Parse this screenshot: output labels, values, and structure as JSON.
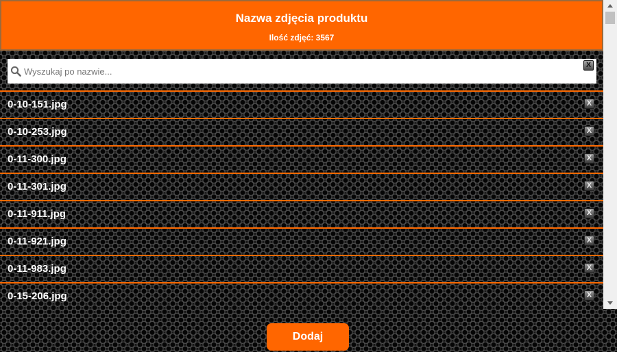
{
  "header": {
    "title": "Nazwa zdjęcia produktu",
    "count_label": "Ilość zdjęć: 3567"
  },
  "search": {
    "placeholder": "Wyszukaj po nazwie...",
    "value": "",
    "clear_label": "X",
    "icon": "search-icon"
  },
  "list": {
    "remove_label": "X",
    "items": [
      {
        "name": "0-10-151.jpg"
      },
      {
        "name": "0-10-253.jpg"
      },
      {
        "name": "0-11-300.jpg"
      },
      {
        "name": "0-11-301.jpg"
      },
      {
        "name": "0-11-911.jpg"
      },
      {
        "name": "0-11-921.jpg"
      },
      {
        "name": "0-11-983.jpg"
      },
      {
        "name": "0-15-206.jpg"
      }
    ]
  },
  "footer": {
    "add_label": "Dodaj"
  },
  "colors": {
    "accent": "#ff6600",
    "row_border": "#ff6a00",
    "text": "#ffffff",
    "background": "#1a1a1a"
  }
}
